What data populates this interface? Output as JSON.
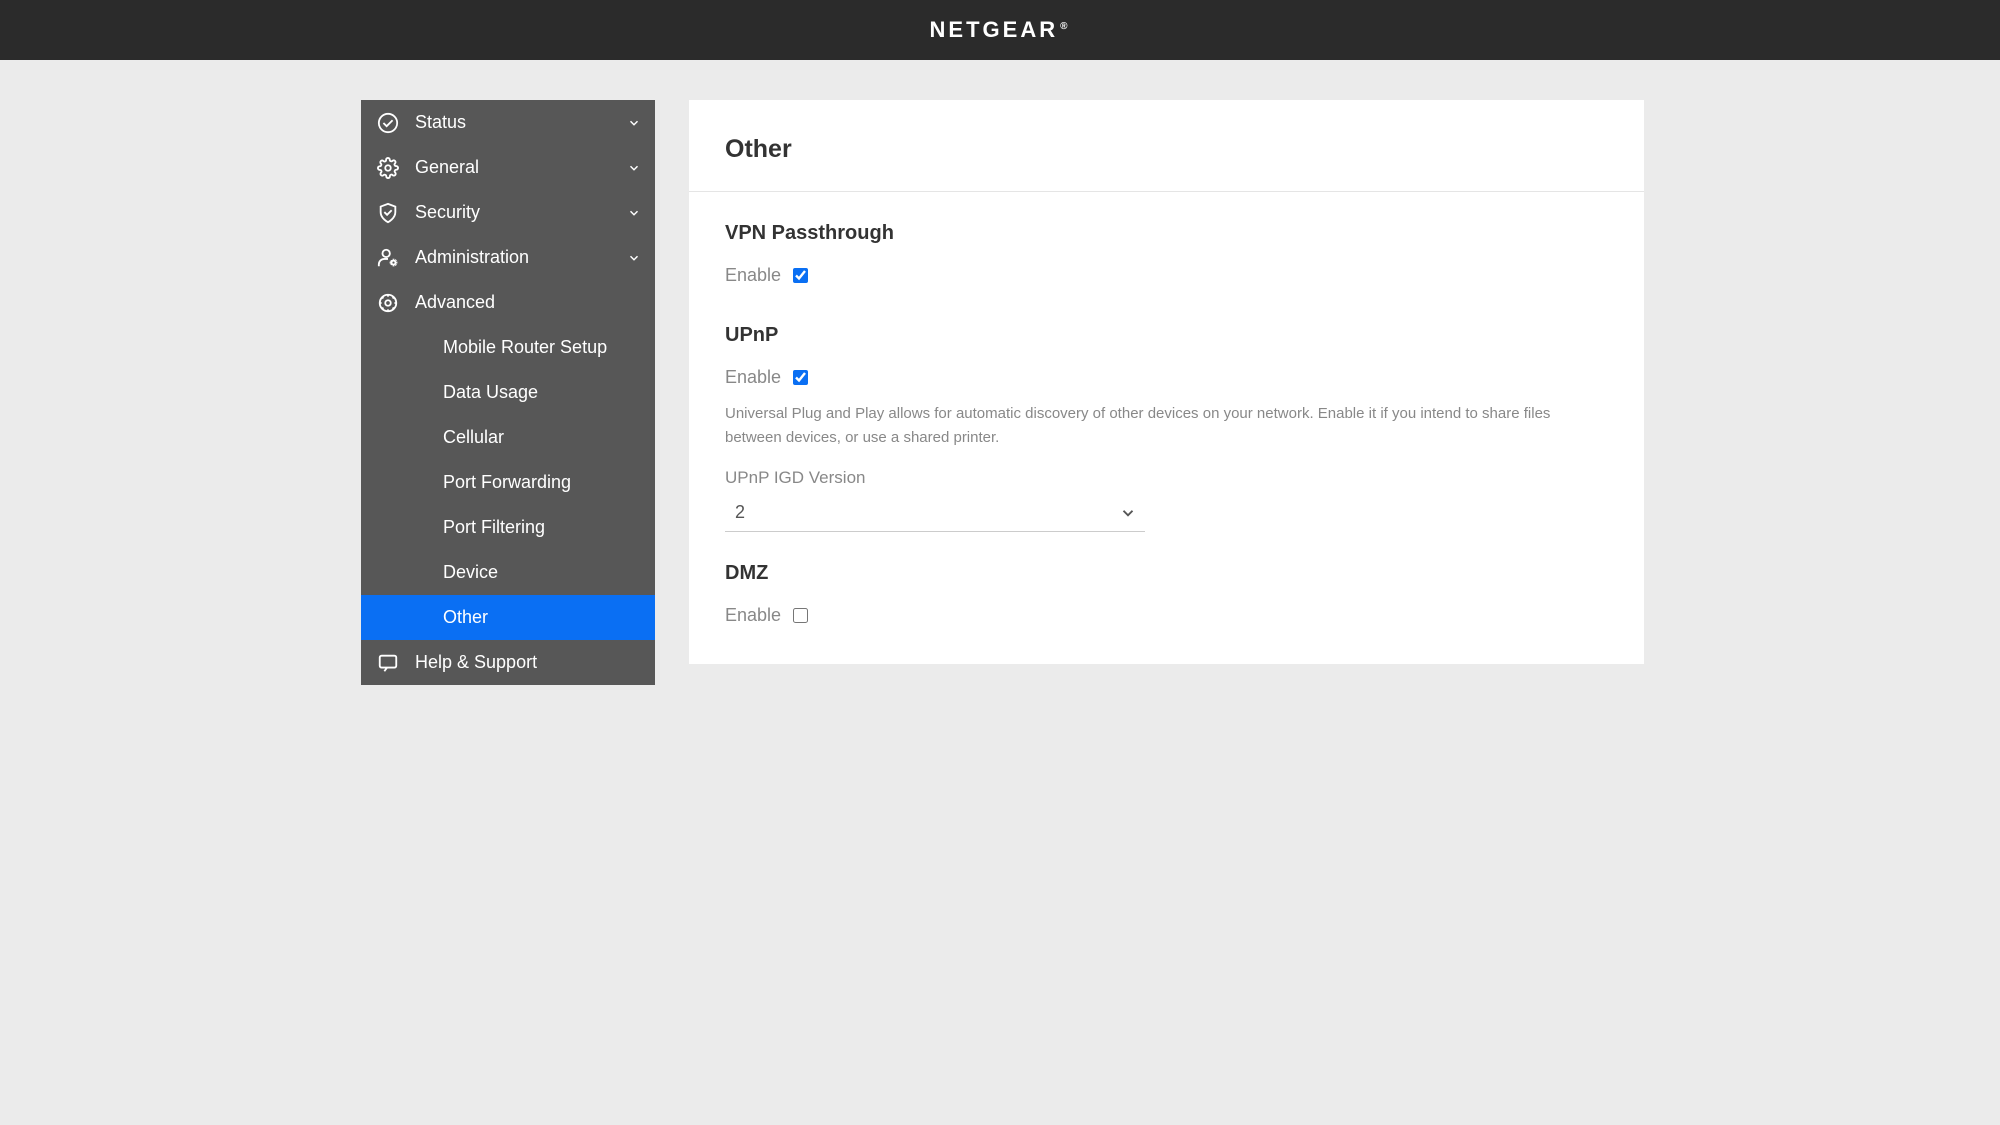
{
  "brand": "NETGEAR",
  "sidebar": {
    "items": [
      {
        "label": "Status",
        "icon": "status-icon",
        "expandable": true
      },
      {
        "label": "General",
        "icon": "gear-icon",
        "expandable": true
      },
      {
        "label": "Security",
        "icon": "shield-icon",
        "expandable": true
      },
      {
        "label": "Administration",
        "icon": "admin-icon",
        "expandable": true
      },
      {
        "label": "Advanced",
        "icon": "advanced-icon",
        "expandable": false,
        "children": [
          {
            "label": "Mobile Router Setup"
          },
          {
            "label": "Data Usage"
          },
          {
            "label": "Cellular"
          },
          {
            "label": "Port Forwarding"
          },
          {
            "label": "Port Filtering"
          },
          {
            "label": "Device"
          },
          {
            "label": "Other",
            "active": true
          }
        ]
      },
      {
        "label": "Help & Support",
        "icon": "chat-icon",
        "expandable": false
      }
    ]
  },
  "main": {
    "title": "Other",
    "vpn": {
      "heading": "VPN Passthrough",
      "enable_label": "Enable",
      "enabled": true
    },
    "upnp": {
      "heading": "UPnP",
      "enable_label": "Enable",
      "enabled": true,
      "description": "Universal Plug and Play allows for automatic discovery of other devices on your network. Enable it if you intend to share files between devices, or use a shared printer.",
      "igd_label": "UPnP IGD Version",
      "igd_value": "2"
    },
    "dmz": {
      "heading": "DMZ",
      "enable_label": "Enable",
      "enabled": false
    }
  },
  "colors": {
    "accent": "#0a6ff3",
    "sidebar_bg": "#575757",
    "header_bg": "#2b2b2b"
  }
}
